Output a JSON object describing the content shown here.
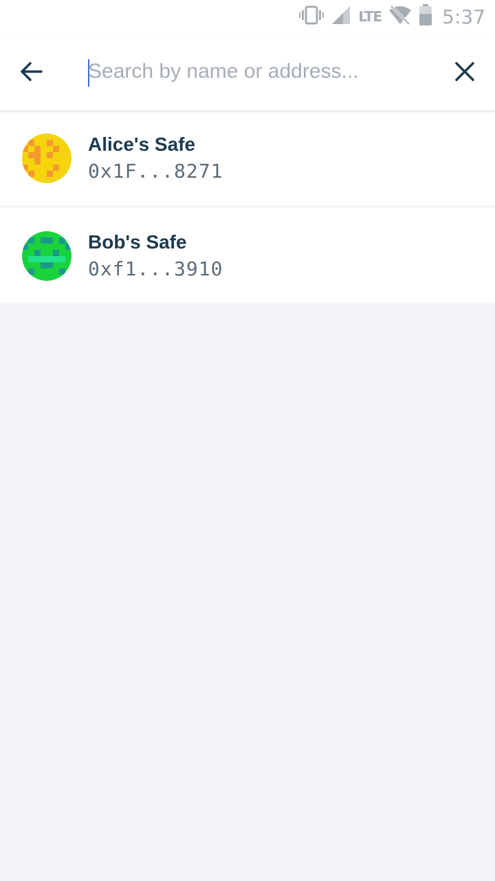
{
  "status_bar": {
    "time": "5:37",
    "network": "LTE",
    "icons": [
      "vibrate-icon",
      "signal-icon",
      "wifi-off-icon",
      "battery-icon"
    ]
  },
  "search": {
    "placeholder": "Search by name or address...",
    "value": "",
    "back_icon": "arrow-left-icon",
    "clear_icon": "close-icon"
  },
  "safes": [
    {
      "name": "Alice's Safe",
      "address": "0x1F...8271",
      "avatar_colors": {
        "base": "#f5d40e",
        "accent": "#f39a2e"
      }
    },
    {
      "name": "Bob's Safe",
      "address": "0xf1...3910",
      "avatar_colors": {
        "base": "#19d33d",
        "accent": "#1a9a8a"
      }
    }
  ],
  "colors": {
    "text_primary": "#1d3a4f",
    "background": "#f2f4f8",
    "accent_caret": "#3c6fd8"
  }
}
